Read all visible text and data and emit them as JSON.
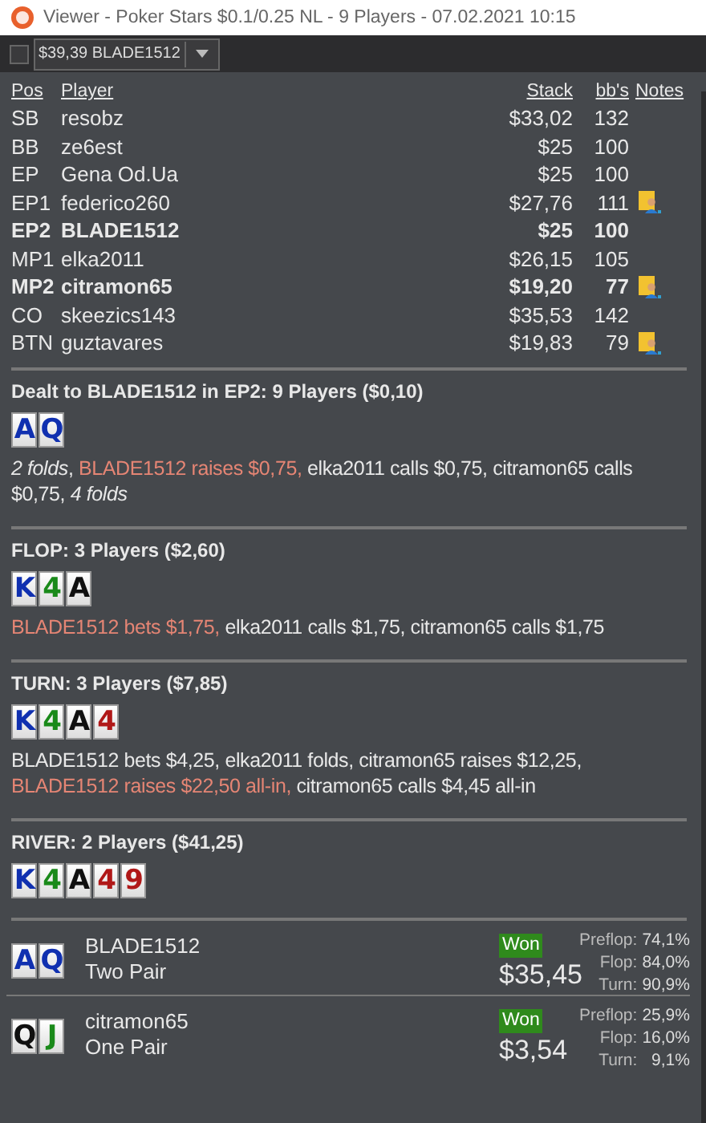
{
  "window": {
    "title": "Viewer - Poker Stars $0.1/0.25 NL - 9 Players - 07.02.2021 10:15"
  },
  "toolbar": {
    "checked": false,
    "hand_select": "$39,39 BLADE1512"
  },
  "table": {
    "columns": [
      "Pos",
      "Player",
      "Stack",
      "bb's",
      "Notes"
    ],
    "rows": [
      {
        "pos": "SB",
        "player": "resobz",
        "stack": "$33,02",
        "bbs": "132",
        "note": false,
        "hero": false
      },
      {
        "pos": "BB",
        "player": "ze6est",
        "stack": "$25",
        "bbs": "100",
        "note": false,
        "hero": false
      },
      {
        "pos": "EP",
        "player": "Gena Od.Ua",
        "stack": "$25",
        "bbs": "100",
        "note": false,
        "hero": false
      },
      {
        "pos": "EP1",
        "player": "federico260",
        "stack": "$27,76",
        "bbs": "111",
        "note": true,
        "hero": false
      },
      {
        "pos": "EP2",
        "player": "BLADE1512",
        "stack": "$25",
        "bbs": "100",
        "note": false,
        "hero": true
      },
      {
        "pos": "MP1",
        "player": "elka2011",
        "stack": "$26,15",
        "bbs": "105",
        "note": false,
        "hero": false
      },
      {
        "pos": "MP2",
        "player": "citramon65",
        "stack": "$19,20",
        "bbs": "77",
        "note": true,
        "hero": true
      },
      {
        "pos": "CO",
        "player": "skeezics143",
        "stack": "$35,53",
        "bbs": "142",
        "note": false,
        "hero": false
      },
      {
        "pos": "BTN",
        "player": "guztavares",
        "stack": "$19,83",
        "bbs": "79",
        "note": true,
        "hero": false
      }
    ]
  },
  "streets": [
    {
      "heading": "Dealt to BLADE1512 in EP2: 9 Players ($0,10)",
      "cards": [
        {
          "rank": "A",
          "color": "#1030b0"
        },
        {
          "rank": "Q",
          "color": "#1030b0"
        }
      ],
      "actions": [
        {
          "kind": "fold",
          "text": "2 folds"
        },
        {
          "kind": "plain",
          "text": ", "
        },
        {
          "kind": "hero",
          "text": "BLADE1512 raises $0,75,"
        },
        {
          "kind": "plain",
          "text": " elka2011 calls $0,75, citramon65 calls $0,75,"
        },
        {
          "kind": "fold",
          "text": " 4 folds"
        }
      ]
    },
    {
      "heading": "FLOP: 3 Players ($2,60)",
      "cards": [
        {
          "rank": "K",
          "color": "#1030b0"
        },
        {
          "rank": "4",
          "color": "#1a8a1a"
        },
        {
          "rank": "A",
          "color": "#101010"
        }
      ],
      "actions": [
        {
          "kind": "hero",
          "text": "BLADE1512 bets $1,75,"
        },
        {
          "kind": "plain",
          "text": " elka2011 calls $1,75, citramon65 calls $1,75"
        }
      ]
    },
    {
      "heading": "TURN: 3 Players ($7,85)",
      "cards": [
        {
          "rank": "K",
          "color": "#1030b0"
        },
        {
          "rank": "4",
          "color": "#1a8a1a"
        },
        {
          "rank": "A",
          "color": "#101010"
        },
        {
          "rank": "4",
          "color": "#b01818"
        }
      ],
      "actions": [
        {
          "kind": "plain",
          "text": "BLADE1512 bets $4,25, elka2011 folds, citramon65 raises $12,25, "
        },
        {
          "kind": "hero",
          "text": "BLADE1512 raises $22,50 all-in,"
        },
        {
          "kind": "plain",
          "text": " citramon65 calls $4,45 all-in"
        }
      ]
    },
    {
      "heading": "RIVER: 2 Players ($41,25)",
      "cards": [
        {
          "rank": "K",
          "color": "#1030b0"
        },
        {
          "rank": "4",
          "color": "#1a8a1a"
        },
        {
          "rank": "A",
          "color": "#101010"
        },
        {
          "rank": "4",
          "color": "#b01818"
        },
        {
          "rank": "9",
          "color": "#b01818"
        }
      ]
    }
  ],
  "results": [
    {
      "cards": [
        {
          "rank": "A",
          "color": "#1030b0"
        },
        {
          "rank": "Q",
          "color": "#1030b0"
        }
      ],
      "player": "BLADE1512",
      "hand": "Two Pair",
      "badge": "Won",
      "amount": "$35,45",
      "equity": [
        {
          "label": "Preflop:",
          "value": "74,1%"
        },
        {
          "label": "Flop:",
          "value": "84,0%"
        },
        {
          "label": "Turn:",
          "value": "90,9%"
        }
      ]
    },
    {
      "cards": [
        {
          "rank": "Q",
          "color": "#101010"
        },
        {
          "rank": "J",
          "color": "#1a8a1a"
        }
      ],
      "player": "citramon65",
      "hand": "One Pair",
      "badge": "Won",
      "amount": "$3,54",
      "equity": [
        {
          "label": "Preflop:",
          "value": "25,9%"
        },
        {
          "label": "Flop:",
          "value": "16,0%"
        },
        {
          "label": "Turn:",
          "value": "9,1%"
        }
      ]
    }
  ]
}
